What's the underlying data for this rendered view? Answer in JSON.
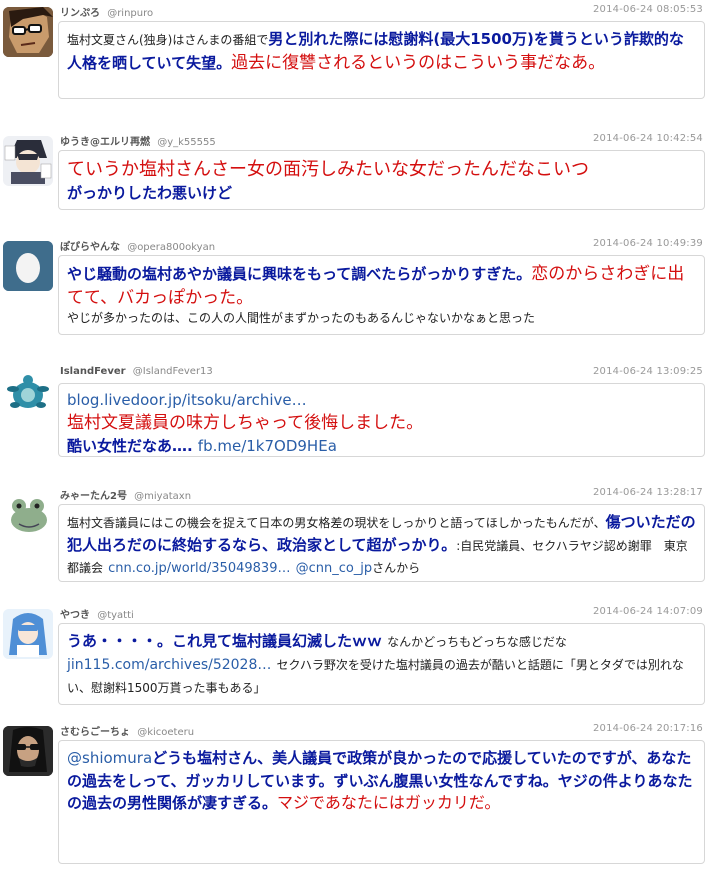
{
  "tweets": [
    {
      "name": "リンぷろ",
      "handle": "@rinpuro",
      "time": "2014-06-24 08:05:53",
      "p1": "塩村文夏さん(独身)はさんまの番組で",
      "p2": "男と別れた際には慰謝料(最大1500万)を貰うという詐欺的な人格を晒していて失望。",
      "p3": "過去に復讐されるというのはこういう事だなあ。"
    },
    {
      "name": "ゆうき@エルリ再燃",
      "handle": "@y_k55555",
      "time": "2014-06-24 10:42:54",
      "p1": "ていうか塩村さんさー女の面汚しみたいな女だったんだなこいつ",
      "p2": "がっかりしたわ悪いけど"
    },
    {
      "name": "ぽぴらやんな",
      "handle": "@opera800okyan",
      "time": "2014-06-24 10:49:39",
      "p1": "やじ騒動の塩村あやか議員に興味をもって調べたらがっかりすぎた。",
      "p2": "恋のからさわぎに出てて、バカっぽかった。",
      "p3": "やじが多かったのは、この人の人間性がまずかったのもあるんじゃないかなぁと思った"
    },
    {
      "name": "IslandFever",
      "handle": "@IslandFever13",
      "time": "2014-06-24 13:09:25",
      "link1": "blog.livedoor.jp/itsoku/archive…",
      "p1": "塩村文夏議員の味方しちゃって後悔しました。",
      "p2": "酷い女性だなあ….",
      "link2": "fb.me/1k7OD9HEa"
    },
    {
      "name": "みゃーたん2号",
      "handle": "@miyataxn",
      "time": "2014-06-24 13:28:17",
      "p1": "塩村文香議員にはこの機会を捉えて日本の男女格差の現状をしっかりと語ってほしかったもんだが、",
      "p2": "傷ついただの犯人出ろだのに終始するなら、政治家として超がっかり。",
      "p3": ":自民党議員、セクハラヤジ認め謝罪　東京都議会",
      "link1": "cnn.co.jp/world/35049839…",
      "link2": "@cnn_co_jp",
      "p4": "さんから"
    },
    {
      "name": "やつき",
      "handle": "@tyatti",
      "time": "2014-06-24 14:07:09",
      "p1": "うあ・・・・。これ見て塩村議員幻滅したｗｗ",
      "p2": "なんかどっちもどっちな感じだな",
      "link1": "jin115.com/archives/52028…",
      "p3": "セクハラ野次を受けた塩村議員の過去が酷いと話題に「男とタダでは別れない、慰謝料1500万貰った事もある」"
    },
    {
      "name": "さむらごーちょ",
      "handle": "@kicoeteru",
      "time": "2014-06-24 20:17:16",
      "link1": "@shiomura",
      "p1": "どうも塩村さん、美人議員で政策が良かったので応援していたのですが、",
      "p2": "あなたの過去をしって、ガッカリしています。ずいぶん腹黒い女性なんですね。ヤジの件よりあなたの過去の男性関係が凄すぎる。",
      "p3": "マジであなたにはガッカリだ。"
    }
  ]
}
